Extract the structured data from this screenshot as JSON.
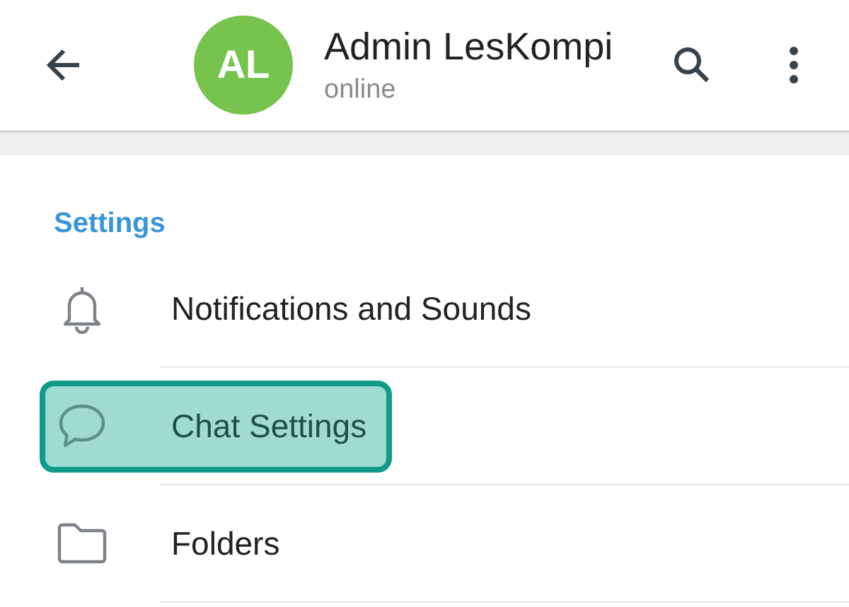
{
  "header": {
    "avatar_initials": "AL",
    "title": "Admin LesKompi",
    "status": "online"
  },
  "section": {
    "title": "Settings",
    "items": [
      {
        "label": "Notifications and Sounds",
        "kind": "bell",
        "highlighted": false
      },
      {
        "label": "Chat Settings",
        "kind": "chat",
        "highlighted": true
      },
      {
        "label": "Folders",
        "kind": "folder",
        "highlighted": false
      }
    ]
  }
}
